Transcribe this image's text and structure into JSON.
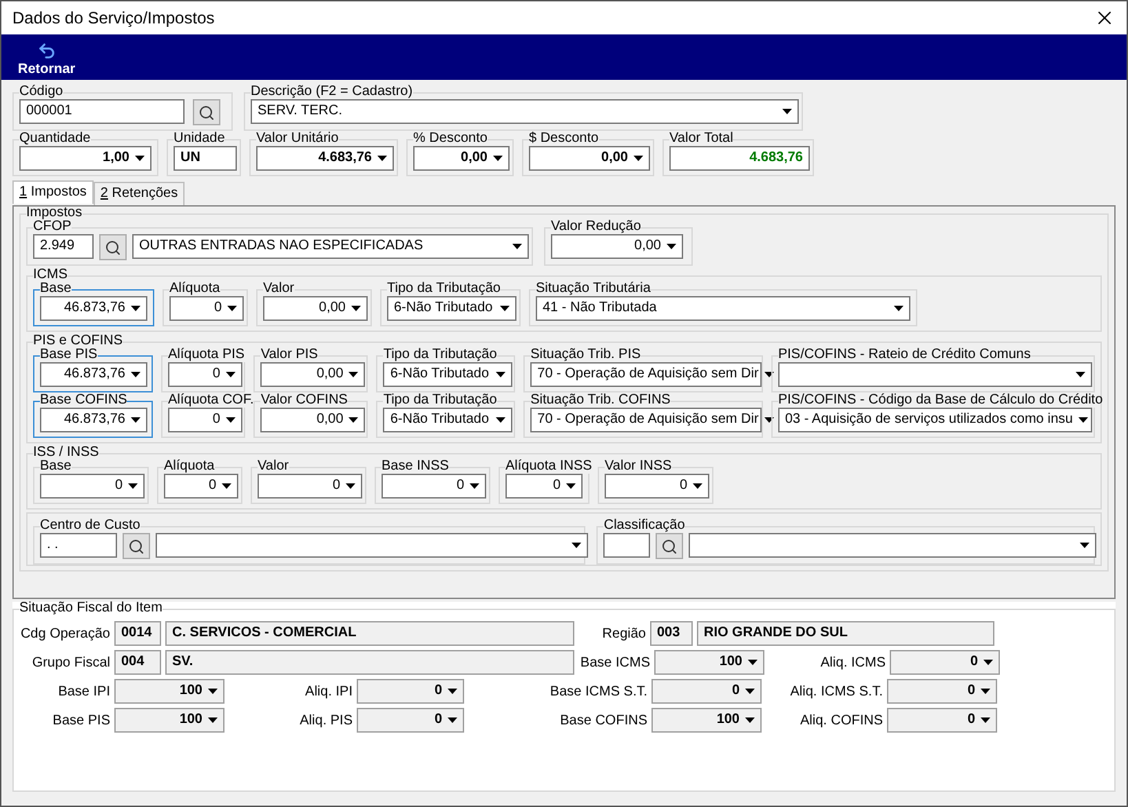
{
  "window": {
    "title": "Dados do Serviço/Impostos"
  },
  "toolbar": {
    "buttons": [
      {
        "label": "Retornar"
      }
    ]
  },
  "header": {
    "codigo": {
      "label": "Código",
      "value": "000001"
    },
    "descricao": {
      "label": "Descrição (F2 = Cadastro)",
      "value": "SERV. TERC."
    },
    "quantidade": {
      "label": "Quantidade",
      "value": "1,00"
    },
    "unidade": {
      "label": "Unidade",
      "value": "UN"
    },
    "valor_unitario": {
      "label": "Valor Unitário",
      "value": "4.683,76"
    },
    "pct_desconto": {
      "label": "% Desconto",
      "value": "0,00"
    },
    "desconto": {
      "label": "$ Desconto",
      "value": "0,00"
    },
    "valor_total": {
      "label": "Valor Total",
      "value": "4.683,76"
    }
  },
  "tabs": [
    {
      "key": "1",
      "label": "Impostos",
      "selected": true
    },
    {
      "key": "2",
      "label": "Retenções",
      "selected": false
    }
  ],
  "impostos": {
    "title": "Impostos",
    "cfop": {
      "label": "CFOP",
      "code": "2.949",
      "description": "OUTRAS ENTRADAS NAO ESPECIFICADAS"
    },
    "valor_reducao": {
      "label": "Valor Redução",
      "value": "0,00"
    },
    "icms": {
      "title": "ICMS",
      "fields": [
        {
          "label": "Base",
          "value": "46.873,76",
          "highlighted": true
        },
        {
          "label": "Alíquota",
          "value": "0",
          "highlighted": false
        },
        {
          "label": "Valor",
          "value": "0,00",
          "highlighted": false
        },
        {
          "label": "Tipo da Tributação",
          "value": "6-Não Tributado",
          "highlighted": false
        },
        {
          "label": "Situação Tributária",
          "value": "41 - Não Tributada",
          "highlighted": false
        }
      ]
    },
    "pis_cofins": {
      "title": "PIS e COFINS",
      "rows": [
        [
          {
            "label": "Base PIS",
            "value": "46.873,76",
            "highlighted": true
          },
          {
            "label": "Alíquota PIS",
            "value": "0",
            "highlighted": false
          },
          {
            "label": "Valor PIS",
            "value": "0,00",
            "highlighted": false
          },
          {
            "label": "Tipo da Tributação",
            "value": "6-Não Tributado",
            "highlighted": false
          },
          {
            "label": "Situação Trib. PIS",
            "value": "70 - Operação de Aquisição sem Dir",
            "highlighted": false
          },
          {
            "label": "PIS/COFINS - Rateio de Crédito Comuns",
            "highlighted": false
          }
        ],
        [
          {
            "label": "Base COFINS",
            "value": "46.873,76",
            "highlighted": true
          },
          {
            "label": "Alíquota COF.",
            "value": "0",
            "highlighted": false
          },
          {
            "label": "Valor COFINS",
            "value": "0,00",
            "highlighted": false
          },
          {
            "label": "Tipo da Tributação",
            "value": "6-Não Tributado",
            "highlighted": false
          },
          {
            "label": "Situação Trib. COFINS",
            "value": "70 - Operação de Aquisição sem Dir",
            "highlighted": false
          },
          {
            "label": "PIS/COFINS - Código da Base de Cálculo do Crédito",
            "value": "03 - Aquisição de serviços utilizados como insu",
            "highlighted": false
          }
        ]
      ]
    },
    "iss_inss": {
      "title": "ISS / INSS",
      "fields": [
        {
          "label": "Base",
          "value": "0"
        },
        {
          "label": "Alíquota",
          "value": "0"
        },
        {
          "label": "Valor",
          "value": "0"
        },
        {
          "label": "Base INSS",
          "value": "0"
        },
        {
          "label": "Alíquota INSS",
          "value": "0"
        },
        {
          "label": "Valor INSS",
          "value": "0"
        }
      ]
    },
    "centro_custo": {
      "label": "Centro de Custo",
      "code": ". ."
    },
    "classificacao": {
      "label": "Classificação"
    }
  },
  "situacao_fiscal": {
    "title": "Situação Fiscal do Item",
    "cdg_operacao": {
      "label": "Cdg Operação",
      "code": "0014",
      "description": "C. SERVICOS - COMERCIAL"
    },
    "regiao": {
      "label": "Região",
      "code": "003",
      "description": "RIO GRANDE DO SUL"
    },
    "grupo_fiscal": {
      "label": "Grupo Fiscal",
      "code": "004",
      "description": "SV."
    },
    "icms_rates": [
      {
        "label": "Base ICMS",
        "value": "100"
      },
      {
        "label": "Aliq. ICMS",
        "value": "0"
      }
    ],
    "rates": [
      [
        {
          "label": "Base IPI",
          "value": "100"
        },
        {
          "label": "Aliq. IPI",
          "value": "0"
        },
        {
          "label": "Base ICMS S.T.",
          "value": "0"
        },
        {
          "label": "Aliq. ICMS S.T.",
          "value": "0"
        }
      ],
      [
        {
          "label": "Base PIS",
          "value": "100"
        },
        {
          "label": "Aliq. PIS",
          "value": "0"
        },
        {
          "label": "Base COFINS",
          "value": "100"
        },
        {
          "label": "Aliq. COFINS",
          "value": "0"
        }
      ]
    ]
  }
}
